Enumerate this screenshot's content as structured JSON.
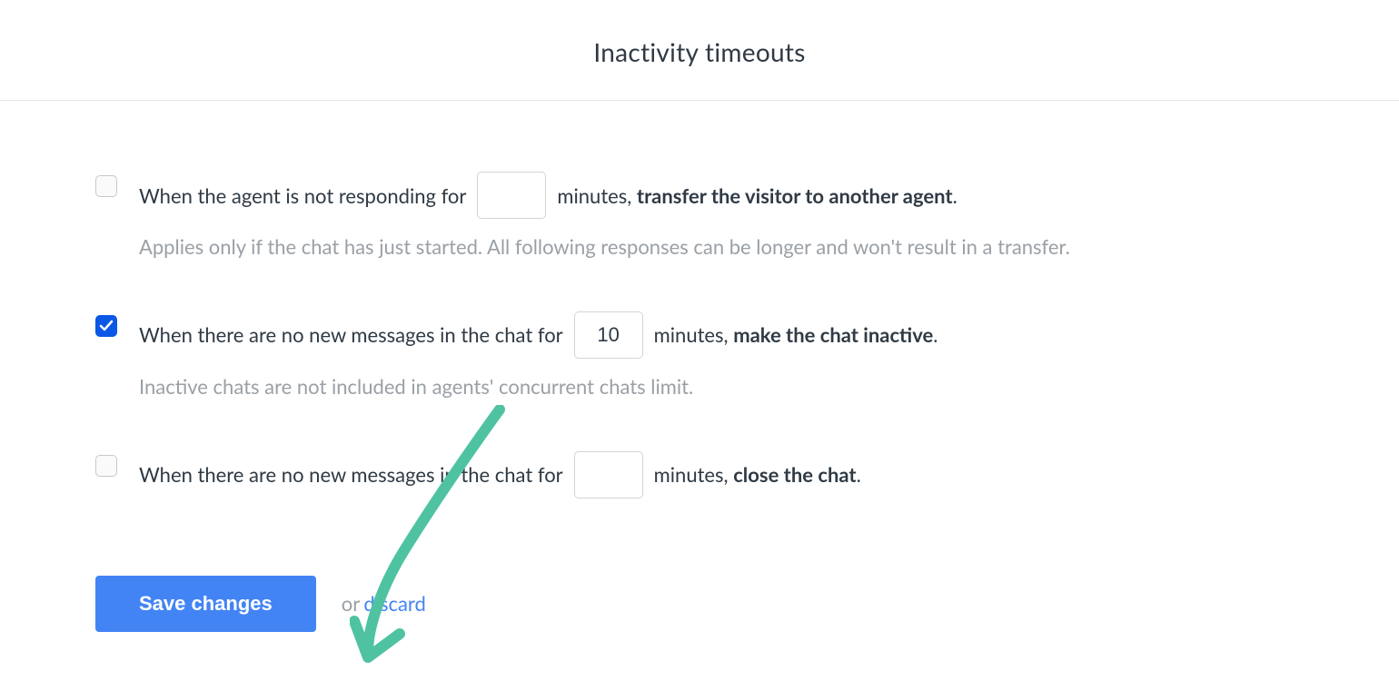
{
  "header": {
    "title": "Inactivity timeouts"
  },
  "options": [
    {
      "checked": false,
      "prefix": "When the agent is not responding for",
      "value": "",
      "suffix_before_bold": "minutes, ",
      "bold_text": "transfer the visitor to another agent",
      "suffix_after_bold": ".",
      "help": "Applies only if the chat has just started. All following responses can be longer and won't result in a transfer."
    },
    {
      "checked": true,
      "prefix": "When there are no new messages in the chat for",
      "value": "10",
      "suffix_before_bold": "minutes, ",
      "bold_text": "make the chat inactive",
      "suffix_after_bold": ".",
      "help": "Inactive chats are not included in agents' concurrent chats limit."
    },
    {
      "checked": false,
      "prefix": "When there are no new messages in the chat for",
      "value": "",
      "suffix_before_bold": "minutes, ",
      "bold_text": "close the chat",
      "suffix_after_bold": ".",
      "help": ""
    }
  ],
  "footer": {
    "save_label": "Save changes",
    "or_label": "or",
    "discard_label": "discard"
  },
  "colors": {
    "accent": "#4384f5",
    "checkbox_checked": "#0b57e6",
    "text_primary": "#2f3a44",
    "text_secondary": "#9aa0a6",
    "annotation": "#4fc3a1"
  }
}
